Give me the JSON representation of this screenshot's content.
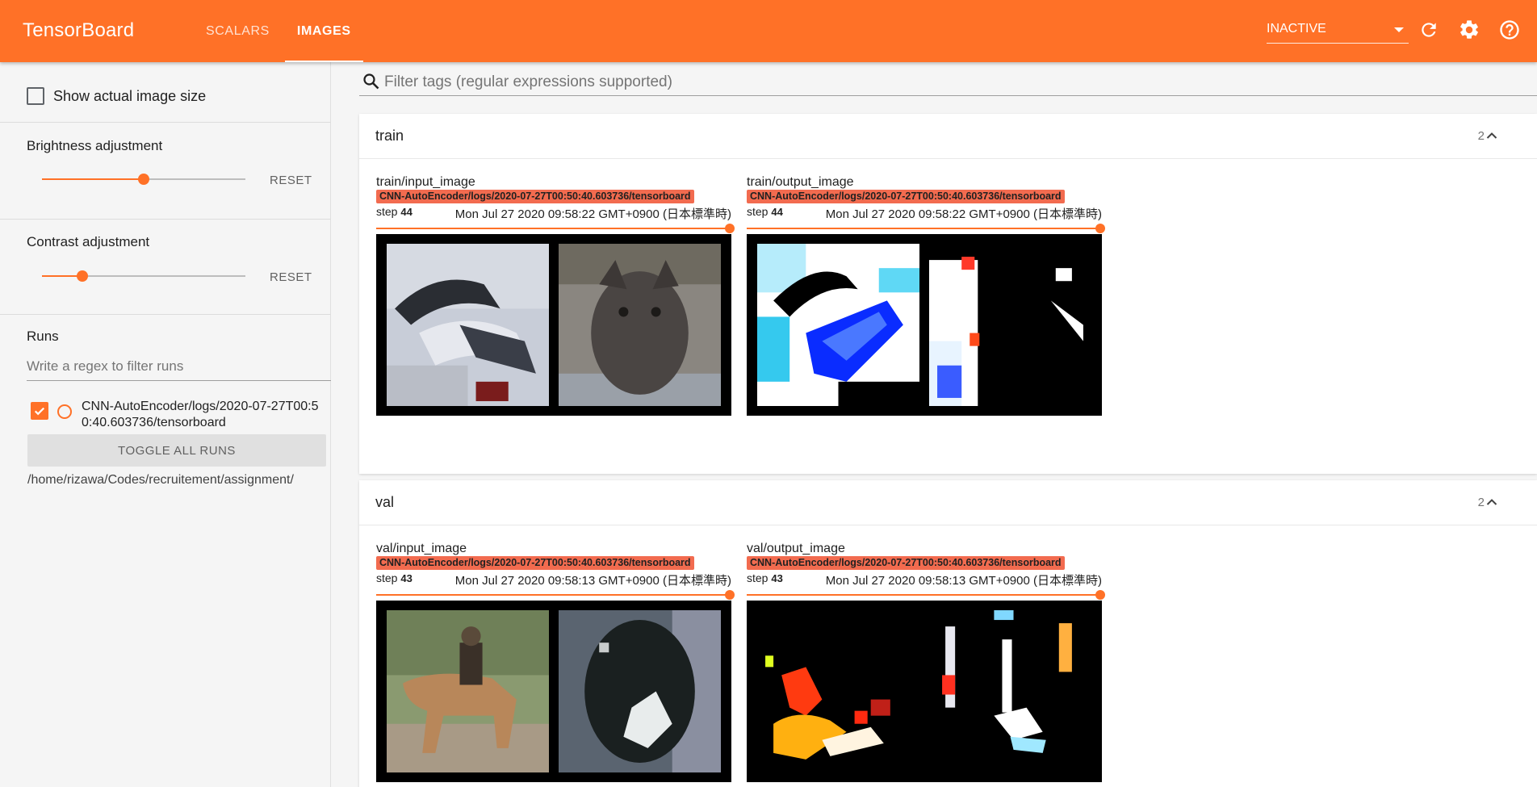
{
  "app": {
    "title": "TensorBoard",
    "accent_color": "#ff7127",
    "tabs": [
      {
        "label": "SCALARS",
        "active": false
      },
      {
        "label": "IMAGES",
        "active": true
      }
    ],
    "reload_select": {
      "value": "INACTIVE"
    },
    "icons": [
      "refresh-icon",
      "settings-icon",
      "help-icon"
    ]
  },
  "sidebar": {
    "show_actual_size": {
      "label": "Show actual image size",
      "checked": false
    },
    "brightness": {
      "title": "Brightness adjustment",
      "value": 0.5,
      "reset_label": "RESET"
    },
    "contrast": {
      "title": "Contrast adjustment",
      "value": 0.2,
      "reset_label": "RESET"
    },
    "runs": {
      "title": "Runs",
      "filter_placeholder": "Write a regex to filter runs",
      "items": [
        {
          "name": "CNN-AutoEncoder/logs/2020-07-27T00:50:40.603736/tensorboard",
          "checked": true,
          "color": "#ff7127"
        }
      ],
      "toggle_label": "TOGGLE ALL RUNS",
      "logdir": "/home/rizawa/Codes/recruitement/assignment/"
    }
  },
  "main": {
    "filter_placeholder": "Filter tags (regular expressions supported)",
    "categories": [
      {
        "name": "train",
        "count": "2",
        "cards": [
          {
            "tag": "train/input_image",
            "run": "CNN-AutoEncoder/logs/2020-07-27T00:50:40.603736/tensorboard",
            "step_label": "step",
            "step": "44",
            "timestamp": "Mon Jul 27 2020 09:58:22 GMT+0900 (日本標準時)",
            "step_position": 1.0
          },
          {
            "tag": "train/output_image",
            "run": "CNN-AutoEncoder/logs/2020-07-27T00:50:40.603736/tensorboard",
            "step_label": "step",
            "step": "44",
            "timestamp": "Mon Jul 27 2020 09:58:22 GMT+0900 (日本標準時)",
            "step_position": 1.0
          }
        ]
      },
      {
        "name": "val",
        "count": "2",
        "cards": [
          {
            "tag": "val/input_image",
            "run": "CNN-AutoEncoder/logs/2020-07-27T00:50:40.603736/tensorboard",
            "step_label": "step",
            "step": "43",
            "timestamp": "Mon Jul 27 2020 09:58:13 GMT+0900 (日本標準時)",
            "step_position": 1.0
          },
          {
            "tag": "val/output_image",
            "run": "CNN-AutoEncoder/logs/2020-07-27T00:50:40.603736/tensorboard",
            "step_label": "step",
            "step": "43",
            "timestamp": "Mon Jul 27 2020 09:58:13 GMT+0900 (日本標準時)",
            "step_position": 1.0
          }
        ]
      }
    ]
  }
}
